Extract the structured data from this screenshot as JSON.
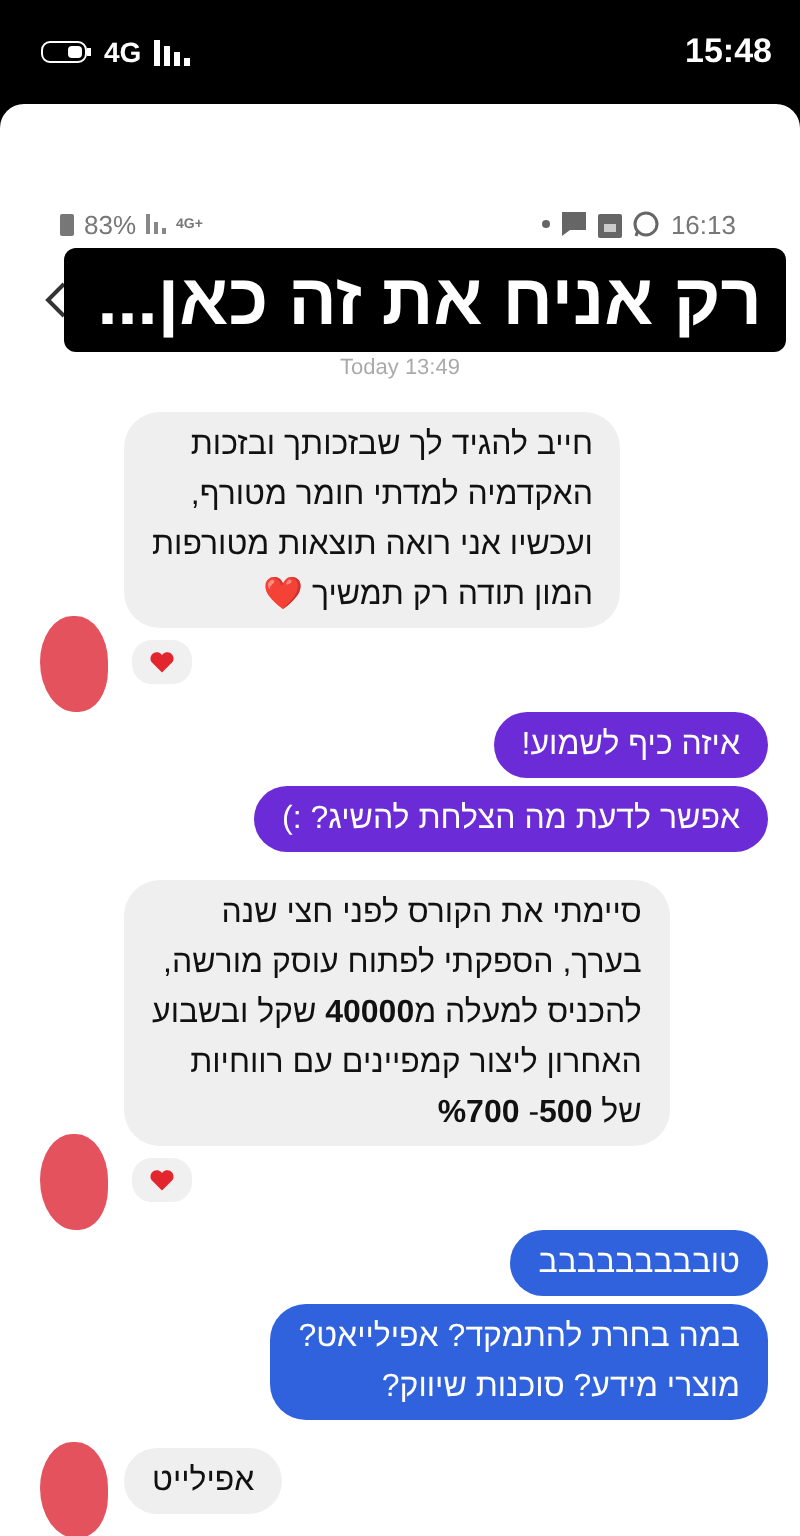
{
  "status_bar": {
    "network": "4G",
    "time": "15:48"
  },
  "inner_status_bar": {
    "battery": "83%",
    "network": "4G+",
    "time": "16:13"
  },
  "caption": "רק אניח את זה כאן...",
  "date_label": "Today 13:49",
  "messages": [
    {
      "kind": "received",
      "text": "חייב להגיד לך שבזכותך ובזכות\nהאקדמיה למדתי חומר מטורף,\nועכשיו אני רואה תוצאות מטורפות\nהמון תודה רק תמשיך ❤️",
      "reaction": true
    },
    {
      "kind": "sent",
      "text": "איזה כיף לשמוע!",
      "color": "#6b2bd6"
    },
    {
      "kind": "sent",
      "text": "אפשר לדעת מה הצלחת להשיג? :)",
      "color": "#6b2bd6"
    },
    {
      "kind": "received",
      "text": "סיימתי את הקורס לפני חצי שנה\nבערך,  הספקתי לפתוח עוסק מורשה,\nלהכניס למעלה מ**40000** שקל ובשבוע\nהאחרון ליצור קמפיינים עם רווחיות\nשל **500**- **%700**",
      "reaction": true
    },
    {
      "kind": "sent",
      "text": "טובבבבבבבבב",
      "color": "#2f62dc"
    },
    {
      "kind": "sent",
      "text": "במה בחרת להתמקד? אפילייאט?\nמוצרי מידע? סוכנות שיווק?",
      "color": "#2f62dc"
    },
    {
      "kind": "received",
      "text": "אפילייט",
      "reaction": false
    }
  ]
}
